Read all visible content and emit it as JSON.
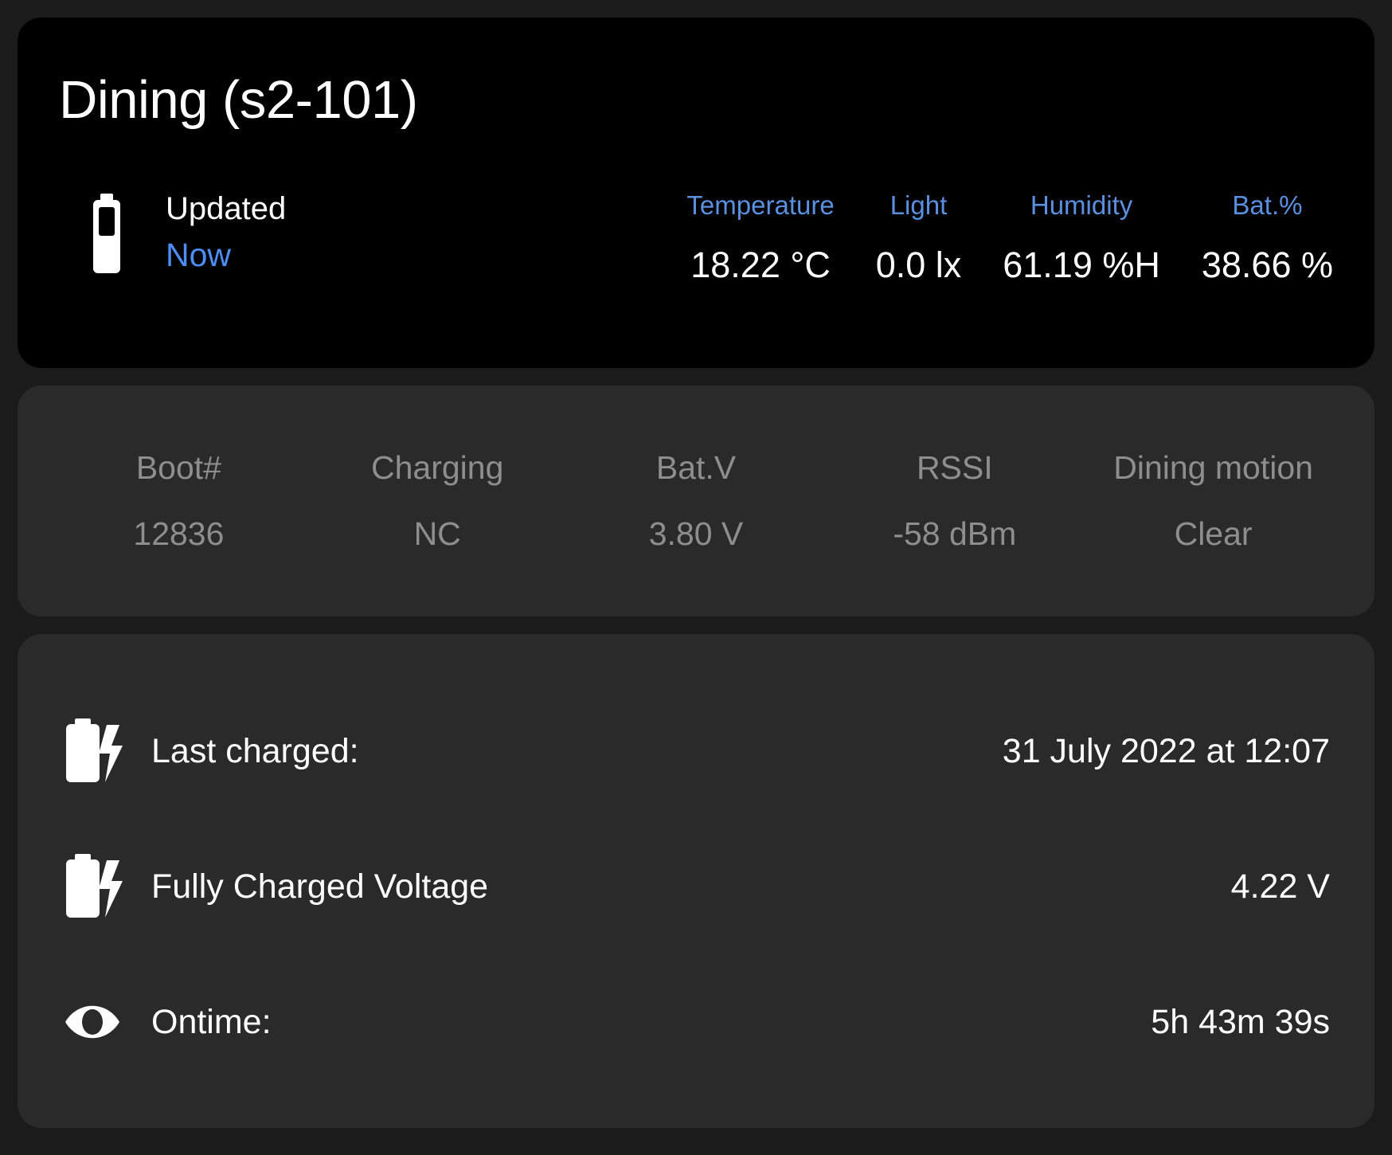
{
  "device": {
    "title": "Dining (s2-101)",
    "battery_icon": "battery-outline-icon"
  },
  "updated": {
    "label": "Updated",
    "value": "Now",
    "accent_color": "#4c8df6"
  },
  "sensors": [
    {
      "label": "Temperature",
      "value": "18.22 °C",
      "name": "temperature"
    },
    {
      "label": "Light",
      "value": "0.0 lx",
      "name": "light"
    },
    {
      "label": "Humidity",
      "value": "61.19 %H",
      "name": "humidity"
    },
    {
      "label": "Bat.%",
      "value": "38.66 %",
      "name": "battery-percent"
    }
  ],
  "stats": [
    {
      "label": "Boot#",
      "value": "12836",
      "name": "boot-count"
    },
    {
      "label": "Charging",
      "value": "NC",
      "name": "charging-state"
    },
    {
      "label": "Bat.V",
      "value": "3.80 V",
      "name": "battery-voltage"
    },
    {
      "label": "RSSI",
      "value": "-58 dBm",
      "name": "rssi"
    },
    {
      "label": "Dining motion",
      "value": "Clear",
      "name": "dining-motion"
    }
  ],
  "details": [
    {
      "icon": "battery-charging-icon",
      "label": "Last charged:",
      "value": "31 July 2022 at 12:07"
    },
    {
      "icon": "battery-charging-icon",
      "label": "Fully Charged Voltage",
      "value": "4.22 V"
    },
    {
      "icon": "eye-icon",
      "label": "Ontime:",
      "value": "5h 43m 39s"
    }
  ],
  "colors": {
    "page_background": "#1b1b1b",
    "header_card": "#000000",
    "card": "#2a2a2a",
    "accent_blue": "#4c8df6",
    "label_blue": "#5b8fe0",
    "muted_gray": "#8e8e8e",
    "text_white": "#ffffff"
  }
}
